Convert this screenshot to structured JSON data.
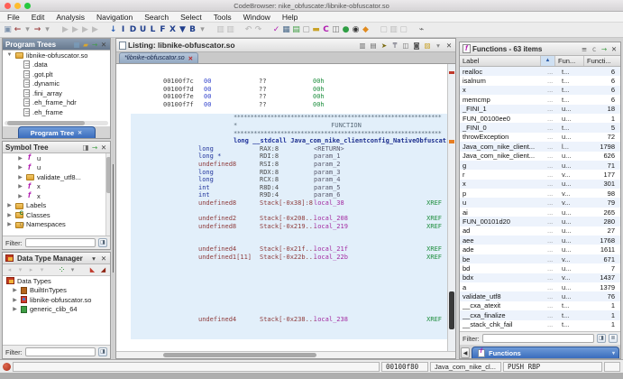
{
  "window": {
    "title": "CodeBrowser: nike_obfuscate:/libnike-obfuscator.so"
  },
  "menu": [
    "File",
    "Edit",
    "Analysis",
    "Navigation",
    "Search",
    "Select",
    "Tools",
    "Window",
    "Help"
  ],
  "toolbar": {
    "icons": [
      {
        "name": "save-icon",
        "g": "▣",
        "c": "#7d92ac"
      },
      {
        "name": "back-icon",
        "g": "←",
        "c": "#a04848"
      },
      {
        "name": "back-dropdown-icon",
        "g": "▾",
        "c": "#999"
      },
      {
        "name": "forward-icon",
        "g": "→",
        "c": "#a04848"
      },
      {
        "name": "forward-dropdown-icon",
        "g": "▾",
        "c": "#999"
      },
      {
        "name": "gap",
        "g": "",
        "cls": "sp"
      },
      {
        "name": "nav-block-icon",
        "g": "▶",
        "cls": "dim"
      },
      {
        "name": "nav-block-icon",
        "g": "▶",
        "cls": "dim"
      },
      {
        "name": "nav-block-icon",
        "g": "▶",
        "cls": "dim"
      },
      {
        "name": "nav-block-icon",
        "g": "▶",
        "cls": "dim"
      },
      {
        "name": "gap",
        "g": "",
        "cls": "sp"
      },
      {
        "name": "goto-icon",
        "g": "↓",
        "c": "#2b5fb4"
      },
      {
        "name": "instruction-icon",
        "g": "I",
        "c": "#1f3e8c"
      },
      {
        "name": "data-icon",
        "g": "D",
        "c": "#1f3e8c"
      },
      {
        "name": "undefine-icon",
        "g": "U",
        "c": "#1f3e8c"
      },
      {
        "name": "label-icon",
        "g": "L",
        "c": "#1f3e8c"
      },
      {
        "name": "function-icon",
        "g": "F",
        "c": "#1f3e8c"
      },
      {
        "name": "clear-icon",
        "g": "X",
        "c": "#1f3e8c"
      },
      {
        "name": "clear-flow-icon",
        "g": "▼",
        "c": "#1f3e8c"
      },
      {
        "name": "bookmark-letter-icon",
        "g": "B",
        "c": "#1f3e8c"
      },
      {
        "name": "dropdown-caret-icon",
        "g": "▾",
        "c": "#999"
      },
      {
        "name": "gap",
        "g": "",
        "cls": "sp"
      },
      {
        "name": "select-icon",
        "g": "▥",
        "cls": "dim"
      },
      {
        "name": "select-icon",
        "g": "▥",
        "cls": "dim"
      },
      {
        "name": "gap",
        "g": "",
        "cls": "sp"
      },
      {
        "name": "undo-icon",
        "g": "↶",
        "cls": "dim"
      },
      {
        "name": "redo-icon",
        "g": "↷",
        "cls": "dim"
      },
      {
        "name": "gap",
        "g": "",
        "cls": "sp"
      },
      {
        "name": "validate-icon",
        "g": "✓",
        "c": "#b01bb0"
      },
      {
        "name": "table-icon",
        "g": "▦",
        "c": "#4a6a8a"
      },
      {
        "name": "memory-map-icon",
        "g": "▤",
        "c": "#3f9d44"
      },
      {
        "name": "window-icon",
        "g": "▢",
        "c": "#999"
      },
      {
        "name": "bookmark-icon",
        "g": "▬",
        "c": "#c9a227"
      },
      {
        "name": "clear-code-icon",
        "g": "C",
        "c": "#b01bb0"
      },
      {
        "name": "call-tree-icon",
        "g": "◫",
        "c": "#777"
      },
      {
        "name": "run-icon",
        "g": "●",
        "c": "#2f9e44"
      },
      {
        "name": "debug-icon",
        "g": "◉",
        "c": "#333"
      },
      {
        "name": "diamond-icon",
        "g": "◆",
        "c": "#e08a1e"
      },
      {
        "name": "gap",
        "g": "",
        "cls": "sp"
      },
      {
        "name": "misc-icon",
        "g": "▢",
        "cls": "dim"
      },
      {
        "name": "misc-icon",
        "g": "▥",
        "cls": "dim"
      },
      {
        "name": "misc-icon",
        "g": "▢",
        "cls": "dim"
      },
      {
        "name": "gap",
        "g": "",
        "cls": "sp"
      },
      {
        "name": "plugin-icon",
        "g": "⌁",
        "c": "#666"
      }
    ]
  },
  "program_trees": {
    "title": "Program Trees",
    "header_icons": [
      {
        "name": "tree-view-icon",
        "g": "▦",
        "c": "#7aa0c0"
      },
      {
        "name": "folder-icon",
        "g": "▰",
        "c": "#d9a62e"
      },
      {
        "name": "snapshot-icon",
        "g": "→",
        "c": "#3f9d44"
      },
      {
        "name": "close-icon",
        "g": "✕",
        "c": "#444"
      }
    ],
    "root": "libnike-obfuscator.so",
    "items": [
      {
        "icon": "page",
        "label": ".data"
      },
      {
        "icon": "page",
        "label": ".got.plt"
      },
      {
        "icon": "page",
        "label": ".dynamic"
      },
      {
        "icon": "page",
        "label": ".fini_array"
      },
      {
        "icon": "page",
        "label": ".eh_frame_hdr"
      },
      {
        "icon": "page",
        "label": ".eh_frame"
      }
    ],
    "tab": "Program Tree"
  },
  "symbol_tree": {
    "title": "Symbol Tree",
    "header_icons": [
      {
        "name": "refresh-icon",
        "g": "◨",
        "cls": "dim"
      },
      {
        "name": "snapshot-icon",
        "g": "→",
        "c": "#3f9d44"
      },
      {
        "name": "close-icon",
        "g": "✕",
        "c": "#444"
      }
    ],
    "items": [
      {
        "icon": "fn",
        "label": "u",
        "d": "d1"
      },
      {
        "icon": "fn",
        "label": "u",
        "d": "d1"
      },
      {
        "icon": "folder",
        "label": "validate_utf8...",
        "d": "d1"
      },
      {
        "icon": "fn",
        "label": "x",
        "d": "d1"
      },
      {
        "icon": "fn",
        "label": "x",
        "d": "d1"
      },
      {
        "icon": "folder",
        "label": "Labels",
        "d": "d0"
      },
      {
        "icon": "folder-c",
        "label": "Classes",
        "d": "d0"
      },
      {
        "icon": "folder-n",
        "label": "Namespaces",
        "d": "d0"
      }
    ],
    "filter_label": "Filter:"
  },
  "data_type_manager": {
    "title": "Data Type Manager",
    "header_icons": [
      {
        "name": "menu-caret-icon",
        "g": "▾",
        "c": "#444"
      },
      {
        "name": "close-icon",
        "g": "✕",
        "c": "#444"
      }
    ],
    "toolbar_icons": [
      {
        "name": "back-icon",
        "g": "◂",
        "cls": "dim"
      },
      {
        "name": "caret-icon",
        "g": "▾",
        "cls": "dim"
      },
      {
        "name": "forward-icon",
        "g": "▸",
        "cls": "dim"
      },
      {
        "name": "caret-icon",
        "g": "▾",
        "cls": "dim"
      },
      {
        "name": "gap",
        "g": "",
        "cls": "sp"
      },
      {
        "name": "organize-icon",
        "g": "⁘",
        "c": "#3f9d44"
      },
      {
        "name": "caret-icon",
        "g": "▾",
        "c": "#888"
      },
      {
        "name": "gap",
        "g": "",
        "cls": "sp"
      },
      {
        "name": "filter-arrows-icon",
        "g": "◣",
        "c": "#c0392b"
      },
      {
        "name": "filter-arrows-icon",
        "g": "◢",
        "c": "#8e2413"
      },
      {
        "name": "gap",
        "g": "",
        "cls": "sp"
      },
      {
        "name": "collapse-icon",
        "g": "▭",
        "c": "#777"
      }
    ],
    "root": "Data Types",
    "items": [
      {
        "icon": "dt-builtin",
        "label": "BuiltInTypes"
      },
      {
        "icon": "dt-prog",
        "label": "libnike-obfuscator.so"
      },
      {
        "icon": "dt-clib",
        "label": "generic_clib_64"
      }
    ],
    "filter_label": "Filter:"
  },
  "listing": {
    "title": "Listing: libnike-obfuscator.so",
    "header_icons": [
      {
        "name": "copy-icon",
        "g": "▥",
        "cls": "dim"
      },
      {
        "name": "paste-icon",
        "g": "▤",
        "cls": "dim"
      },
      {
        "name": "cursor-location-icon",
        "g": "➤",
        "c": "#7a6a10"
      },
      {
        "name": "diff-view-icon",
        "g": "₸",
        "c": "#556"
      },
      {
        "name": "markup-icon",
        "g": "◫",
        "cls": "dim"
      },
      {
        "name": "snapshot-camera-icon",
        "g": "◙",
        "c": "#555"
      },
      {
        "name": "edit-fields-icon",
        "g": "▨",
        "c": "#c9a227"
      },
      {
        "name": "dropdown-caret-icon",
        "g": "▾",
        "c": "#888"
      },
      {
        "name": "close-icon",
        "g": "✕",
        "c": "#444"
      }
    ],
    "tab": "*libnike-obfuscator.so",
    "byte_rows": [
      {
        "addr": "00100f7c",
        "bytes": "00",
        "mnem": "??",
        "val": "00h"
      },
      {
        "addr": "00100f7d",
        "bytes": "00",
        "mnem": "??",
        "val": "00h"
      },
      {
        "addr": "00100f7e",
        "bytes": "00",
        "mnem": "??",
        "val": "00h"
      },
      {
        "addr": "00100f7f",
        "bytes": "00",
        "mnem": "??",
        "val": "00h"
      }
    ],
    "stars": "**************************************************************",
    "banner_star": "*",
    "banner_text": "FUNCTION",
    "signature": {
      "ret": "long",
      "conv": "__stdcall",
      "name": "Java_com_nike_clientconfig_NativeObfuscat..."
    },
    "vars": [
      {
        "type": "long",
        "storage": "RAX:8",
        "name": "<RETURN>",
        "xref": ""
      },
      {
        "type": "long *",
        "storage": "RDI:8",
        "name": "param_1",
        "xref": ""
      },
      {
        "type": "undefined8",
        "storage": "RSI:8",
        "name": "param_2",
        "xref": ""
      },
      {
        "type": "long",
        "storage": "RDX:8",
        "name": "param_3",
        "xref": ""
      },
      {
        "type": "long",
        "storage": "RCX:8",
        "name": "param_4",
        "xref": ""
      },
      {
        "type": "int",
        "storage": "R8D:4",
        "name": "param_5",
        "xref": ""
      },
      {
        "type": "int",
        "storage": "R9D:4",
        "name": "param_6",
        "xref": ""
      },
      {
        "type": "undefined8",
        "storage": "Stack[-0x38]:8",
        "name": "local_38",
        "xref": "XREF",
        "cls": ""
      },
      {
        "type": "",
        "storage": "",
        "name": "",
        "xref": "",
        "cls": "sp"
      },
      {
        "type": "undefined2",
        "storage": "Stack[-0x208...",
        "name": "local_208",
        "xref": "XREF"
      },
      {
        "type": "undefined8",
        "storage": "Stack[-0x219...",
        "name": "local_219",
        "xref": "XREF"
      },
      {
        "type": "",
        "storage": "",
        "name": "",
        "xref": "",
        "cls": "sp"
      },
      {
        "type": "",
        "storage": "",
        "name": "",
        "xref": "",
        "cls": "sp"
      },
      {
        "type": "undefined4",
        "storage": "Stack[-0x21f...",
        "name": "local_21f",
        "xref": "XREF"
      },
      {
        "type": "undefined1[11]",
        "storage": "Stack[-0x22b...",
        "name": "local_22b",
        "xref": "XREF"
      },
      {
        "type": "",
        "storage": "",
        "name": "",
        "xref": "",
        "cls": "sp"
      },
      {
        "type": "",
        "storage": "",
        "name": "",
        "xref": "",
        "cls": "sp"
      },
      {
        "type": "",
        "storage": "",
        "name": "",
        "xref": "",
        "cls": "sp"
      },
      {
        "type": "",
        "storage": "",
        "name": "",
        "xref": "",
        "cls": "sp"
      },
      {
        "type": "",
        "storage": "",
        "name": "",
        "xref": "",
        "cls": "sp"
      },
      {
        "type": "",
        "storage": "",
        "name": "",
        "xref": "",
        "cls": "sp"
      },
      {
        "type": "",
        "storage": "",
        "name": "",
        "xref": "",
        "cls": "sp"
      },
      {
        "type": "undefined4",
        "storage": "Stack[-0x238...",
        "name": "local_238",
        "xref": "XREF"
      }
    ]
  },
  "functions_panel": {
    "title": "Functions - 63 items",
    "header_icons": [
      {
        "name": "list-icon",
        "g": "≡",
        "c": "#555"
      },
      {
        "name": "copy-icon",
        "g": "c",
        "c": "#777"
      },
      {
        "name": "snapshot-icon",
        "g": "→",
        "c": "#3f9d44"
      },
      {
        "name": "close-icon",
        "g": "✕",
        "c": "#444"
      }
    ],
    "columns": {
      "label": "Label",
      "sig": "Fun...",
      "size": "Functi..."
    },
    "sort_glyph": "▲",
    "rows": [
      {
        "label": "realloc",
        "loc": "...",
        "sig": "t...",
        "size": "6"
      },
      {
        "label": "isalnum",
        "loc": "...",
        "sig": "t...",
        "size": "6"
      },
      {
        "label": "x",
        "loc": "...",
        "sig": "t...",
        "size": "6"
      },
      {
        "label": "memcmp",
        "loc": "...",
        "sig": "t...",
        "size": "6"
      },
      {
        "label": "_FINI_1",
        "loc": "...",
        "sig": "u...",
        "size": "18"
      },
      {
        "label": "FUN_00100ee0",
        "loc": "...",
        "sig": "u...",
        "size": "1"
      },
      {
        "label": "_FINI_0",
        "loc": "...",
        "sig": "t...",
        "size": "5"
      },
      {
        "label": "throwException",
        "loc": "...",
        "sig": "u...",
        "size": "72"
      },
      {
        "label": "Java_com_nike_client...",
        "loc": "...",
        "sig": "l...",
        "size": "1798"
      },
      {
        "label": "Java_com_nike_client...",
        "loc": "...",
        "sig": "u...",
        "size": "626"
      },
      {
        "label": "g",
        "loc": "...",
        "sig": "u...",
        "size": "71"
      },
      {
        "label": "r",
        "loc": "...",
        "sig": "v...",
        "size": "177"
      },
      {
        "label": "x",
        "loc": "...",
        "sig": "u...",
        "size": "301"
      },
      {
        "label": "p",
        "loc": "...",
        "sig": "v...",
        "size": "98"
      },
      {
        "label": "u",
        "loc": "...",
        "sig": "v...",
        "size": "79"
      },
      {
        "label": "ai",
        "loc": "...",
        "sig": "u...",
        "size": "265"
      },
      {
        "label": "FUN_00101d20",
        "loc": "...",
        "sig": "u...",
        "size": "280"
      },
      {
        "label": "ad",
        "loc": "...",
        "sig": "u...",
        "size": "27"
      },
      {
        "label": "aee",
        "loc": "...",
        "sig": "u...",
        "size": "1768"
      },
      {
        "label": "ade",
        "loc": "...",
        "sig": "u...",
        "size": "1611"
      },
      {
        "label": "be",
        "loc": "...",
        "sig": "v...",
        "size": "671"
      },
      {
        "label": "bd",
        "loc": "...",
        "sig": "u...",
        "size": "7"
      },
      {
        "label": "bdx",
        "loc": "...",
        "sig": "v...",
        "size": "1437"
      },
      {
        "label": "a",
        "loc": "...",
        "sig": "u...",
        "size": "1379"
      },
      {
        "label": "validate_utf8",
        "loc": "...",
        "sig": "u...",
        "size": "76"
      },
      {
        "label": "__cxa_atexit",
        "loc": "...",
        "sig": "t...",
        "size": "1"
      },
      {
        "label": "__cxa_finalize",
        "loc": "...",
        "sig": "t...",
        "size": "1"
      },
      {
        "label": "__stack_chk_fail",
        "loc": "...",
        "sig": "t...",
        "size": "1"
      }
    ],
    "filter_label": "Filter:",
    "tab": "Functions"
  },
  "status_bar": {
    "address": "00100f80",
    "function": "Java_com_nike_cl...",
    "instruction": "PUSH RBP"
  }
}
